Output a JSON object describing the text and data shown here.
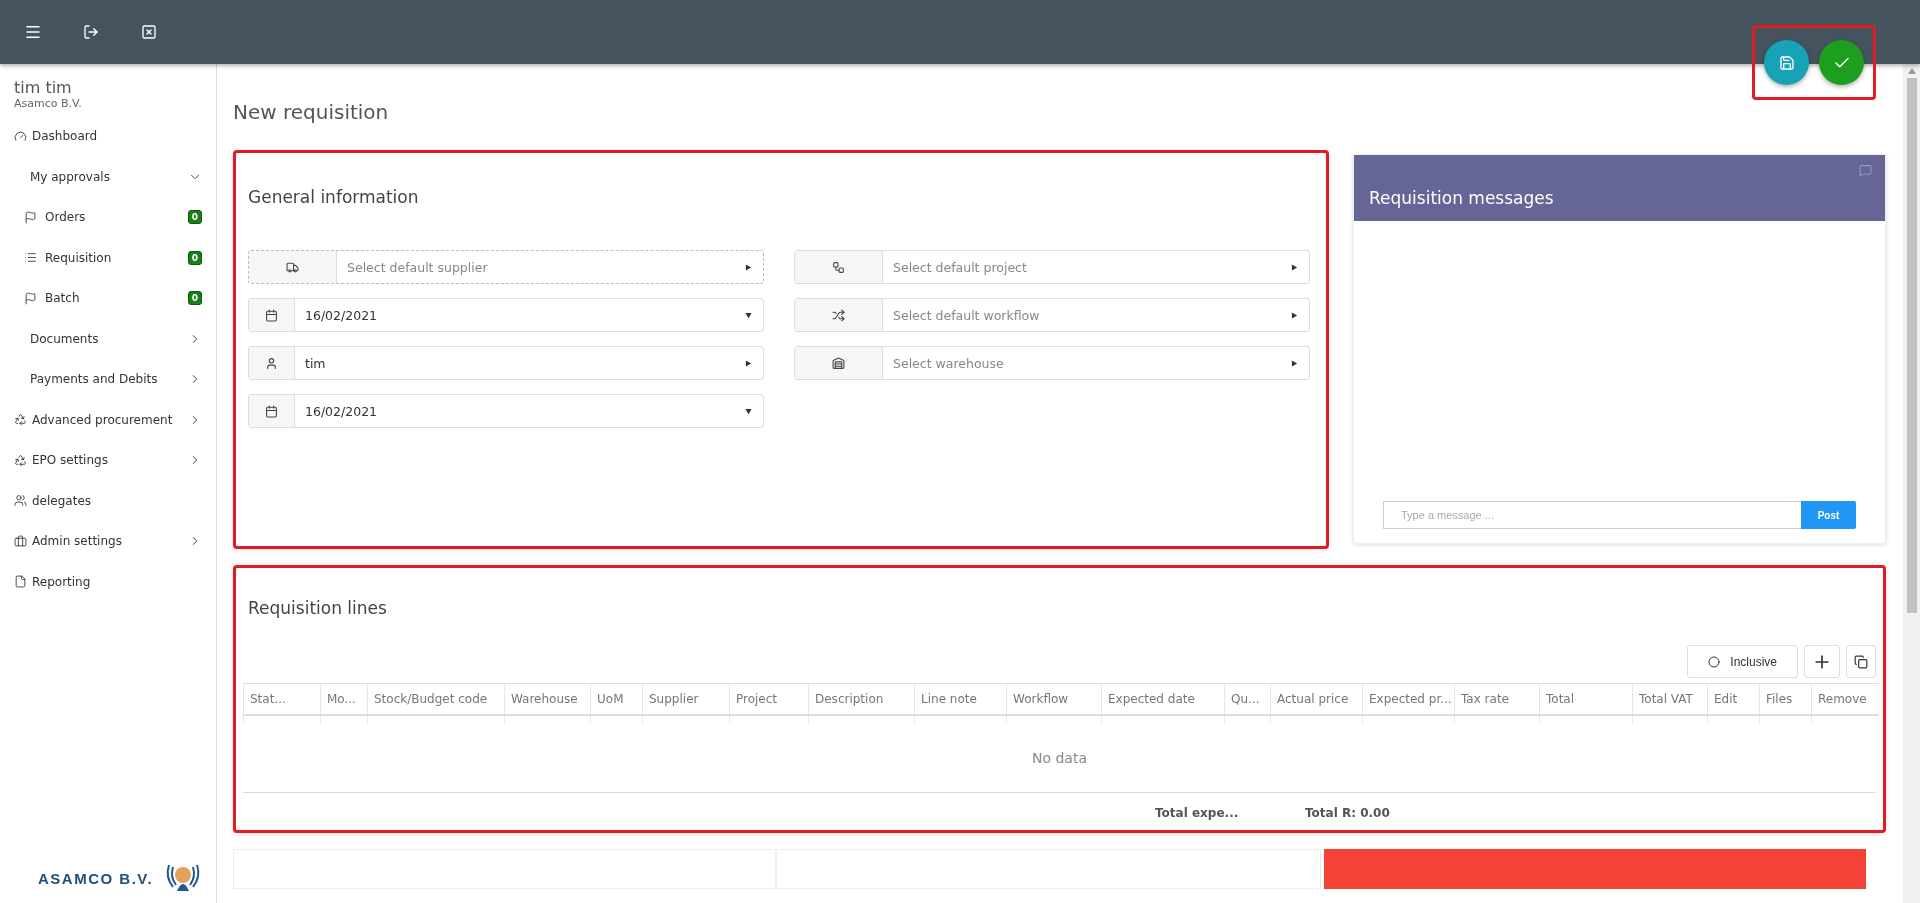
{
  "user": {
    "name": "tim tim",
    "company": "Asamco B.V."
  },
  "sidebar": {
    "items": [
      {
        "label": "Dashboard",
        "kind": "top"
      },
      {
        "label": "My approvals",
        "kind": "group",
        "expanded": true,
        "children": [
          {
            "label": "Orders",
            "badge": "0"
          },
          {
            "label": "Requisition",
            "badge": "0"
          },
          {
            "label": "Batch",
            "badge": "0"
          }
        ]
      },
      {
        "label": "Documents",
        "kind": "group",
        "expanded": false
      },
      {
        "label": "Payments and Debits",
        "kind": "group",
        "expanded": false
      },
      {
        "label": "Advanced procurement",
        "kind": "top",
        "expanded": false
      },
      {
        "label": "EPO settings",
        "kind": "top",
        "expanded": false
      },
      {
        "label": "delegates",
        "kind": "top"
      },
      {
        "label": "Admin settings",
        "kind": "top",
        "expanded": false
      },
      {
        "label": "Reporting",
        "kind": "top"
      }
    ]
  },
  "logo": {
    "text": "ASAMCO B.V."
  },
  "page": {
    "title": "New requisition"
  },
  "general": {
    "title": "General information",
    "left_fields": [
      {
        "kind": "select",
        "placeholder": "Select default supplier",
        "focused": true
      },
      {
        "kind": "date",
        "value": "16/02/2021",
        "focused": false
      },
      {
        "kind": "select",
        "value": "tim",
        "focused": false
      },
      {
        "kind": "date",
        "value": "16/02/2021",
        "focused": false
      }
    ],
    "right_fields": [
      {
        "kind": "select",
        "placeholder": "Select default project",
        "focused": false
      },
      {
        "kind": "select",
        "placeholder": "Select default workflow",
        "focused": false
      },
      {
        "kind": "select",
        "placeholder": "Select warehouse",
        "focused": false
      }
    ]
  },
  "messages": {
    "title": "Requisition messages",
    "input": {
      "placeholder": "Type a message ..."
    },
    "button": "Post"
  },
  "lines": {
    "title": "Requisition lines",
    "inclusive": {
      "label": "Inclusive",
      "checked": false
    },
    "columns": [
      "Stat...",
      "Mo...",
      "Stock/Budget code",
      "Warehouse",
      "UoM",
      "Supplier",
      "Project",
      "Description",
      "Line note",
      "Workflow",
      "Expected date",
      "Qu...",
      "Actual price",
      "Expected pr...",
      "Tax rate",
      "Total",
      "Total VAT",
      "Edit",
      "Files",
      "Remove"
    ],
    "empty": "No data",
    "footer": [
      "Total expe...",
      "Total R: 0.00"
    ]
  }
}
